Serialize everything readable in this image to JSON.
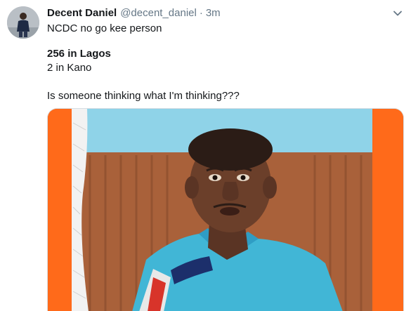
{
  "tweet": {
    "display_name": "Decent Daniel",
    "handle": "@decent_daniel",
    "separator": "·",
    "time": "3m",
    "lines": [
      "NCDC no go kee person",
      "256 in Lagos",
      "2 in Kano",
      "Is someone thinking what I'm thinking???"
    ]
  },
  "icons": {
    "avatar": "user-avatar",
    "caret": "chevron-down-icon",
    "media": "meme-image"
  },
  "colors": {
    "text": "#14171a",
    "secondary": "#657786",
    "border": "#d6dde3",
    "media_frame_orange": "#ff6a1a",
    "media_sky": "#8fd3e8",
    "media_shirt": "#41b6d6"
  }
}
